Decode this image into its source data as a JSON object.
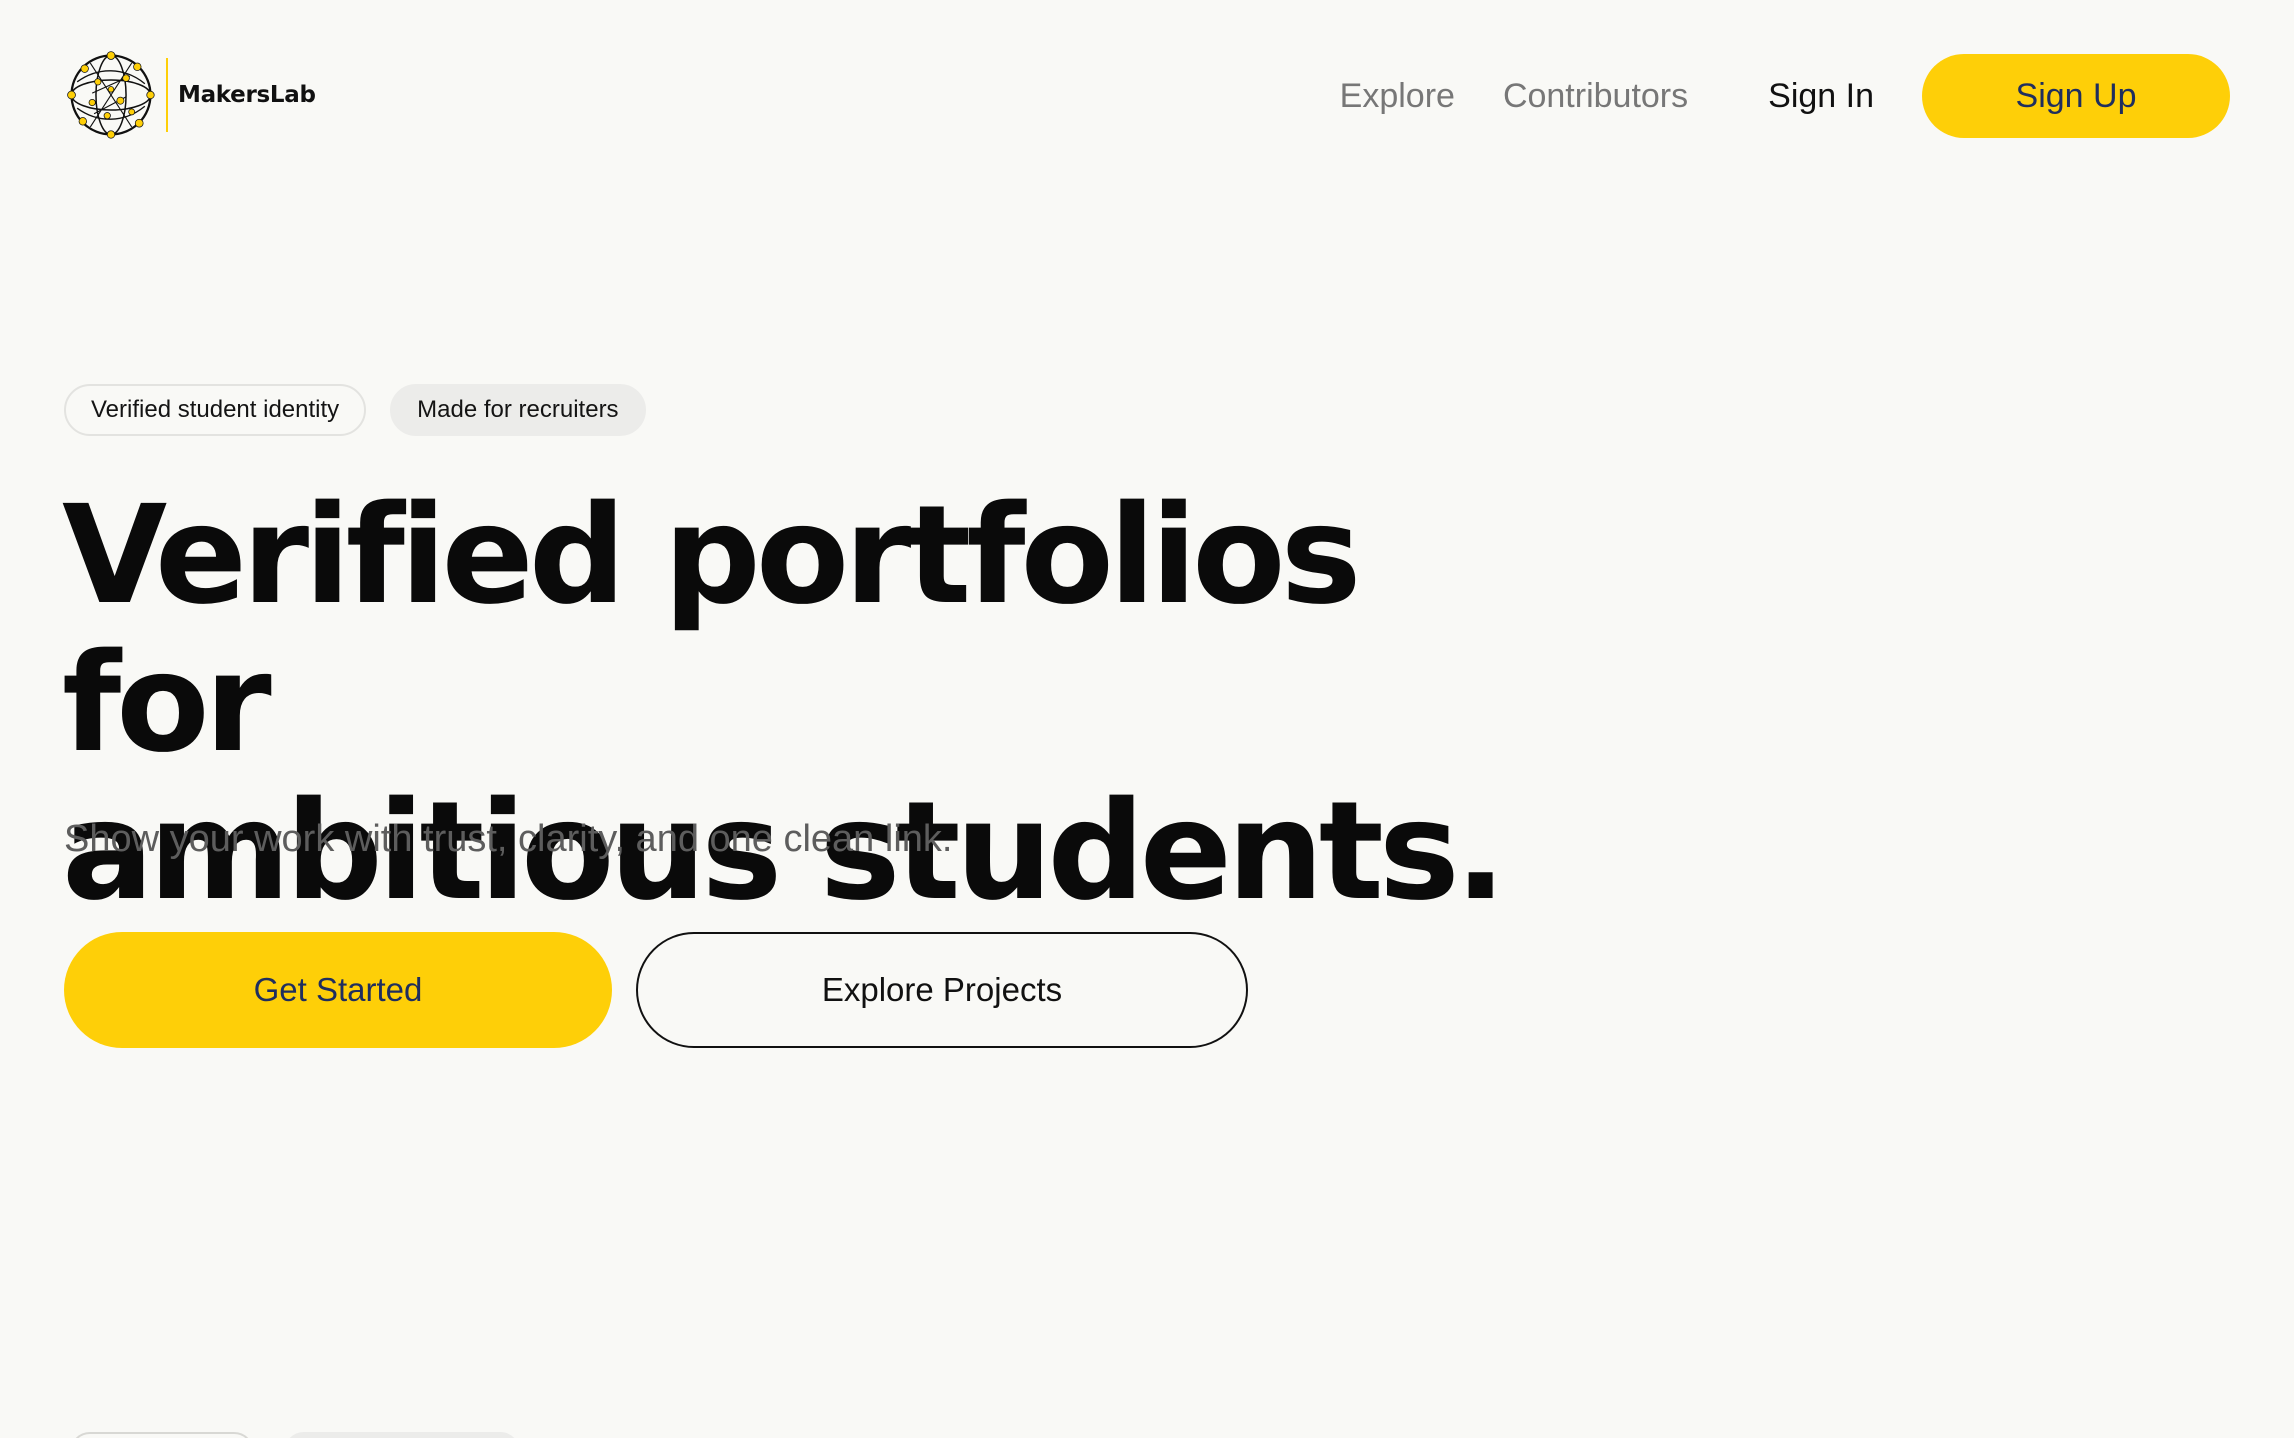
{
  "brand": {
    "name": "MakersLab",
    "logo_icon": "network-globe-icon",
    "accent": "#fecf08"
  },
  "nav": {
    "links": [
      "Explore",
      "Contributors"
    ],
    "sign_in": "Sign In",
    "sign_up": "Sign Up"
  },
  "hero": {
    "badges": [
      "Verified student identity",
      "Made for recruiters"
    ],
    "title_line1": "Verified portfolios for",
    "title_line2": "ambitious students.",
    "subtitle": "Show your work with trust, clarity, and one clean link.",
    "cta_primary": "Get Started",
    "cta_secondary": "Explore Projects"
  },
  "colors": {
    "background": "#f9f9f6",
    "accent": "#fecf08",
    "button_text": "#1f2e5e",
    "muted_text": "#777777"
  }
}
